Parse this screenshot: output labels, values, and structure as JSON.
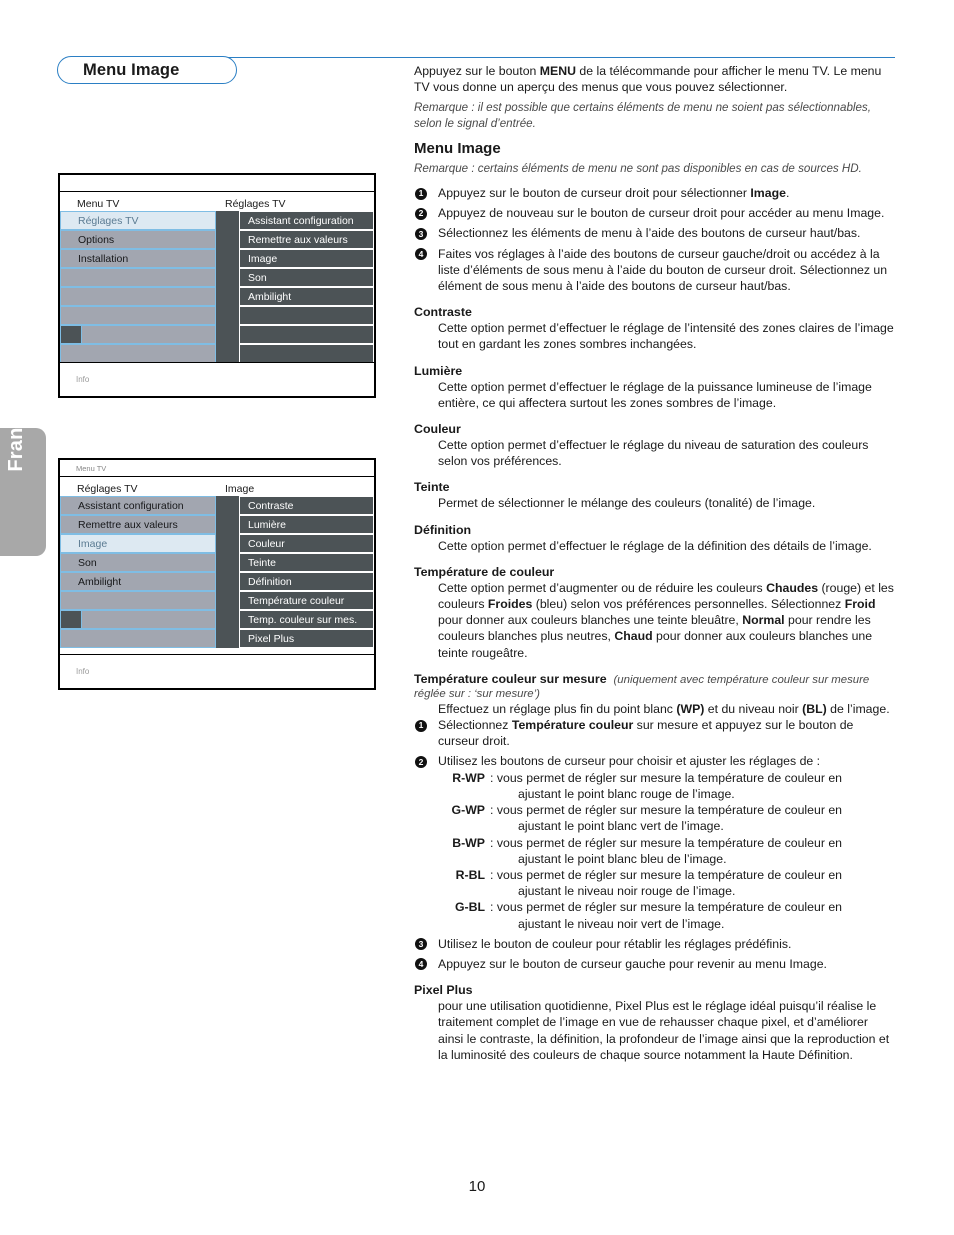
{
  "language_tab": {
    "label": "Française"
  },
  "header": {
    "title": "Menu Image"
  },
  "page": {
    "number": "10"
  },
  "tv_menu_1": {
    "topbar_label": "",
    "col_head_left": "Menu TV",
    "col_head_right": "Réglages TV",
    "left_items": [
      "Réglages TV",
      "Options",
      "Installation",
      "",
      "",
      "",
      "",
      ""
    ],
    "left_selected_index": 0,
    "right_items": [
      "Assistant configuration",
      "Remettre aux valeurs",
      "Image",
      "Son",
      "Ambilight",
      "",
      "",
      ""
    ],
    "info_label": "Info"
  },
  "tv_menu_2": {
    "topbar_label": "Menu TV",
    "col_head_left": "Réglages TV",
    "col_head_right": "Image",
    "left_items": [
      "Assistant configuration",
      "Remettre aux valeurs",
      "Image",
      "Son",
      "Ambilight",
      "",
      "",
      ""
    ],
    "left_selected_index": 2,
    "right_items": [
      "Contraste",
      "Lumière",
      "Couleur",
      "Teinte",
      "Définition",
      "Température couleur",
      "Temp. couleur sur mes.",
      "Pixel Plus"
    ],
    "info_label": "Info"
  },
  "content": {
    "intro": {
      "part1": "Appuyez sur le bouton ",
      "menu_bold": "MENU",
      "part2": " de la télécommande pour afficher le menu TV. Le menu TV vous donne un aperçu des menus que vous pouvez sélectionner."
    },
    "note_intro": "Remarque : il est possible que certains éléments de menu ne soient pas sélectionnables, selon le signal d’entrée.",
    "section_title": "Menu Image",
    "note_section": "Remarque : certains éléments de menu ne sont pas disponibles en cas de sources HD.",
    "steps_main": [
      {
        "num": "1",
        "pre": "Appuyez sur le bouton de curseur droit pour sélectionner ",
        "bold": "Image",
        "post": "."
      },
      {
        "num": "2",
        "pre": "Appuyez de nouveau sur le bouton de curseur droit pour accéder au menu Image.",
        "bold": "",
        "post": ""
      },
      {
        "num": "3",
        "pre": "Sélectionnez les éléments de menu à l’aide des boutons de curseur haut/bas.",
        "bold": "",
        "post": ""
      },
      {
        "num": "4",
        "pre": "Faites vos réglages à l’aide des boutons de curseur gauche/droit ou accédez à la liste d’éléments de sous menu à l’aide du bouton de curseur droit. Sélectionnez un élément de sous menu à l’aide des boutons de curseur haut/bas.",
        "bold": "",
        "post": ""
      }
    ],
    "contraste": {
      "heading": "Contraste",
      "text": "Cette option permet d’effectuer le réglage de l’intensité des zones claires de l’image tout en gardant les zones sombres inchangées."
    },
    "lumiere": {
      "heading": "Lumière",
      "text": "Cette option permet d’effectuer le réglage de la puissance lumineuse de l’image entière, ce qui affectera surtout les zones sombres de l’image."
    },
    "couleur": {
      "heading": "Couleur",
      "text": "Cette option permet d’effectuer le réglage du niveau de saturation des couleurs selon vos préférences."
    },
    "teinte": {
      "heading": "Teinte",
      "text": "Permet de sélectionner le mélange des couleurs (tonalité) de l’image."
    },
    "definition": {
      "heading": "Définition",
      "text": "Cette option permet d’effectuer le réglage de la définition des détails de l’image."
    },
    "temp_couleur": {
      "heading": "Température de couleur",
      "t1": "Cette option permet d’augmenter ou de réduire les couleurs ",
      "b1": "Chaudes",
      "t2": " (rouge) et les couleurs ",
      "b2": "Froides",
      "t3": " (bleu) selon vos préférences personnelles. Sélectionnez ",
      "b3": "Froid",
      "t4": " pour donner aux couleurs blanches une teinte bleuâtre, ",
      "b4": "Normal",
      "t5": " pour rendre les couleurs blanches plus neutres, ",
      "b5": "Chaud",
      "t6": " pour donner aux couleurs blanches une teinte rougeâtre."
    },
    "temp_sur_mesure": {
      "heading": "Température couleur sur mesure",
      "heading_note": "(uniquement avec température couleur sur mesure réglée sur : ‘sur mesure’)",
      "intro_a": "Effectuez un réglage plus fin du point blanc ",
      "intro_b1": "(WP)",
      "intro_b": " et du niveau noir ",
      "intro_b2": "(BL)",
      "intro_c": " de l’image.",
      "step1_num": "1",
      "step1_pre": "Sélectionnez ",
      "step1_bold": "Température couleur",
      "step1_post": " sur mesure et appuyez sur le bouton de curseur droit.",
      "step2_num": "2",
      "step2_text": "Utilisez les boutons de curseur pour choisir et ajuster les réglages de :",
      "definitions": [
        {
          "term": "R-WP",
          "line1": ": vous permet de régler sur mesure la température de couleur en",
          "line2": "ajustant le point blanc rouge de l’image."
        },
        {
          "term": "G-WP",
          "line1": ": vous permet de régler sur mesure la température de couleur en",
          "line2": "ajustant le point blanc vert de l’image."
        },
        {
          "term": "B-WP",
          "line1": ": vous permet de régler sur mesure la température de couleur en",
          "line2": "ajustant le point blanc bleu de l’image."
        },
        {
          "term": "R-BL",
          "line1": ": vous permet de régler sur mesure la température de couleur en",
          "line2": "ajustant le niveau noir rouge de l’image."
        },
        {
          "term": "G-BL",
          "line1": ": vous permet de régler sur mesure la température de couleur en",
          "line2": "ajustant le niveau noir vert de l’image."
        }
      ],
      "step3_num": "3",
      "step3_text": "Utilisez le bouton de couleur pour rétablir les réglages prédéfinis.",
      "step4_num": "4",
      "step4_text": "Appuyez sur le bouton de curseur gauche pour revenir au menu Image."
    },
    "pixel_plus": {
      "heading": "Pixel Plus",
      "text": "pour une utilisation quotidienne, Pixel Plus est le réglage idéal puisqu’il réalise le traitement complet de l’image en vue de rehausser chaque pixel, et d’améliorer ainsi le contraste, la définition, la profondeur de l’image ainsi que la reproduction et la luminosité des couleurs de chaque source notamment la Haute Définition."
    }
  },
  "colors": {
    "accent_blue": "#2b7fc4",
    "menu_dark": "#4c5356",
    "menu_gray": "#a2a6b0",
    "menu_sel": "#dde9f2",
    "menu_border_blue": "#7fbde4",
    "tab_gray": "#a8a8a8"
  }
}
